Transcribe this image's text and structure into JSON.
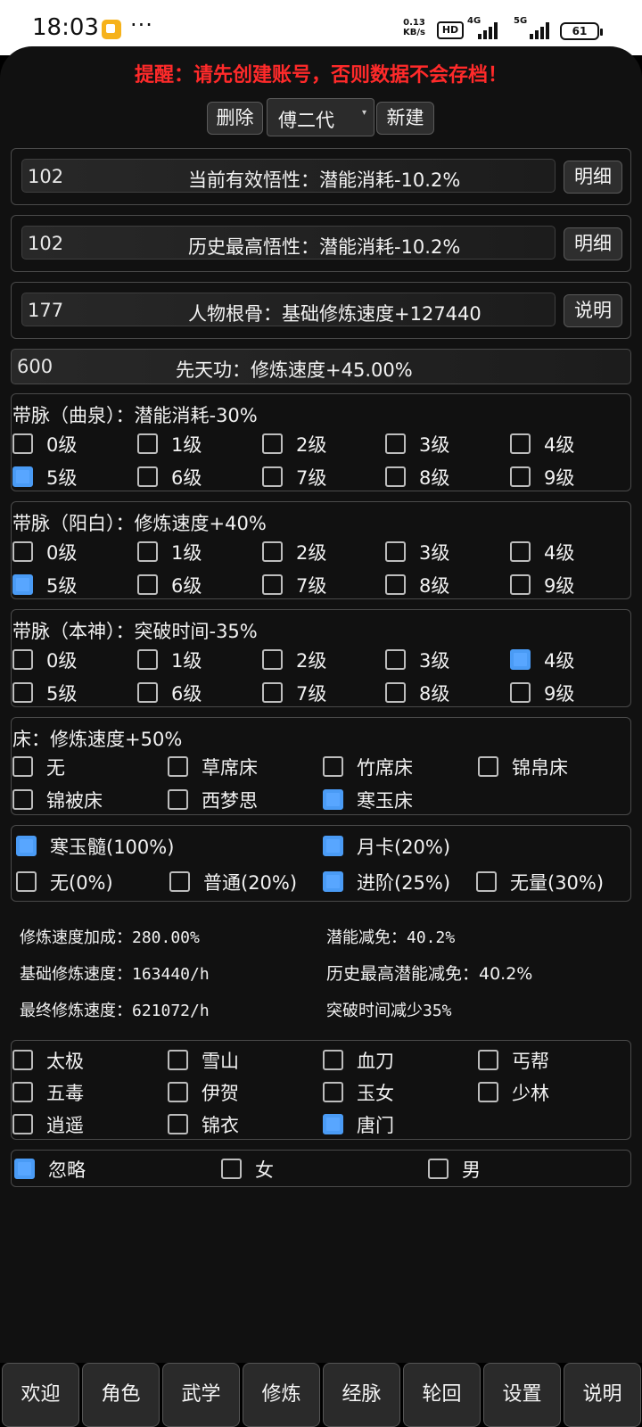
{
  "status_bar": {
    "time": "18:03",
    "dots": "···",
    "speed_value": "0.13",
    "speed_unit": "KB/s",
    "hd": "HD",
    "net1": "4G",
    "net2": "5G",
    "battery": "61"
  },
  "warning": "提醒：请先创建账号，否则数据不会存档！",
  "account": {
    "delete_label": "删除",
    "selected": "傅二代",
    "new_label": "新建"
  },
  "fields": [
    {
      "value": "102",
      "label": "当前有效悟性：潜能消耗-10.2%",
      "button": "明细"
    },
    {
      "value": "102",
      "label": "历史最高悟性：潜能消耗-10.2%",
      "button": "明细"
    },
    {
      "value": "177",
      "label": "人物根骨：基础修炼速度+127440",
      "button": "说明"
    },
    {
      "value": "600",
      "label": "先天功：修炼速度+45.00%"
    }
  ],
  "meridians": [
    {
      "title": "带脉（曲泉）：潜能消耗-30%",
      "levels": [
        "0级",
        "1级",
        "2级",
        "3级",
        "4级",
        "5级",
        "6级",
        "7级",
        "8级",
        "9级"
      ],
      "checked": [
        5
      ]
    },
    {
      "title": "带脉（阳白）：修炼速度+40%",
      "levels": [
        "0级",
        "1级",
        "2级",
        "3级",
        "4级",
        "5级",
        "6级",
        "7级",
        "8级",
        "9级"
      ],
      "checked": [
        5
      ]
    },
    {
      "title": "带脉（本神）：突破时间-35%",
      "levels": [
        "0级",
        "1级",
        "2级",
        "3级",
        "4级",
        "5级",
        "6级",
        "7级",
        "8级",
        "9级"
      ],
      "checked": [
        4
      ]
    }
  ],
  "bed": {
    "title": "床：修炼速度+50%",
    "options": [
      "无",
      "草席床",
      "竹席床",
      "锦帛床",
      "锦被床",
      "西梦思",
      "寒玉床"
    ],
    "checked": [
      6
    ]
  },
  "items": {
    "row1": [
      "寒玉髓(100%)",
      "月卡(20%)"
    ],
    "row1_checked": [
      0,
      1
    ],
    "row2": [
      "无(0%)",
      "普通(20%)",
      "进阶(25%)",
      "无量(30%)"
    ],
    "row2_checked": [
      2
    ]
  },
  "stats": {
    "speed_bonus": "修炼速度加成：280.00%",
    "base_speed": "基础修炼速度：163440/h",
    "final_speed": "最终修炼速度：621072/h",
    "potential": "潜能减免：40.2%",
    "hist_potential": "历史最高潜能减免：40.2%",
    "breakthrough": "突破时间减少35%"
  },
  "sects": {
    "options": [
      "太极",
      "雪山",
      "血刀",
      "丐帮",
      "五毒",
      "伊贺",
      "玉女",
      "少林",
      "逍遥",
      "锦衣",
      "唐门"
    ],
    "checked": [
      10
    ]
  },
  "gender": {
    "options": [
      "忽略",
      "女",
      "男"
    ],
    "checked": [
      0
    ]
  },
  "tabs": [
    "欢迎",
    "角色",
    "武学",
    "修炼",
    "经脉",
    "轮回",
    "设置",
    "说明"
  ],
  "colors": {
    "accent": "#4a9bf5",
    "warning": "#ff2a2a",
    "background": "#111111"
  }
}
